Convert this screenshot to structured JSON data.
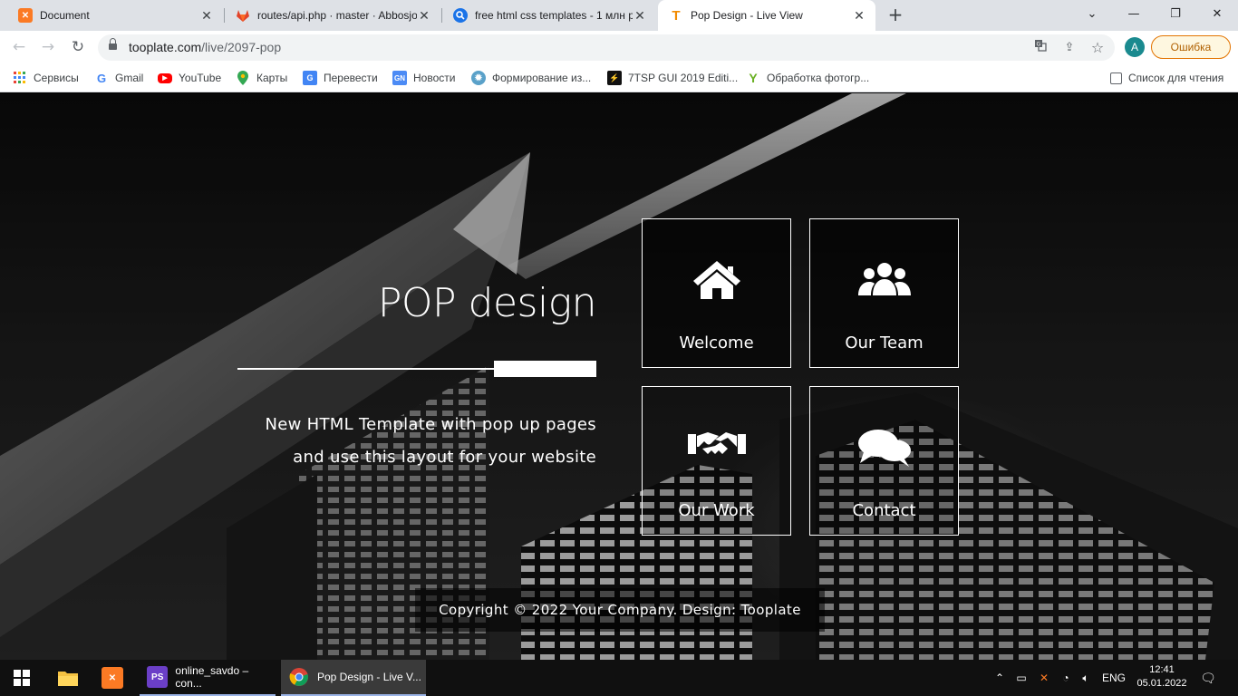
{
  "browser": {
    "tabs": [
      {
        "title": "Document",
        "icon": "xampp-icon",
        "color": "#fb7a24"
      },
      {
        "title": "routes/api.php · master · Abbosjo",
        "icon": "gitlab-icon",
        "color": "#e24329"
      },
      {
        "title": "free html css templates - 1 млн р",
        "icon": "search-icon",
        "color": "#1a73e8"
      },
      {
        "title": "Pop Design - Live View",
        "icon": "tooplate-icon",
        "color": "#f28b00"
      }
    ],
    "address": {
      "host": "tooplate.com",
      "path": "/live/2097-pop"
    },
    "profile_initial": "A",
    "error_button": "Ошибка",
    "bookmarks": [
      "Сервисы",
      "Gmail",
      "YouTube",
      "Карты",
      "Перевести",
      "Новости",
      "Формирование из...",
      "7TSP GUI 2019 Editi...",
      "Обработка фотогр..."
    ],
    "reading_list": "Список для чтения"
  },
  "page": {
    "title": "POP design",
    "subtitle_line1": "New HTML Template with pop up pages",
    "subtitle_line2": "and use this layout for your website",
    "tiles": [
      {
        "label": "Welcome",
        "icon": "home-icon"
      },
      {
        "label": "Our Team",
        "icon": "users-icon"
      },
      {
        "label": "Our Work",
        "icon": "handshake-icon"
      },
      {
        "label": "Contact",
        "icon": "chat-bubbles-icon"
      }
    ],
    "footer": "Copyright © 2022 Your Company. Design: Tooplate"
  },
  "taskbar": {
    "apps": [
      {
        "label": "online_savdo – con...",
        "icon": "phpstorm-icon"
      },
      {
        "label": "Pop Design - Live V...",
        "icon": "chrome-icon"
      }
    ],
    "language": "ENG",
    "time": "12:41",
    "date": "05.01.2022"
  }
}
